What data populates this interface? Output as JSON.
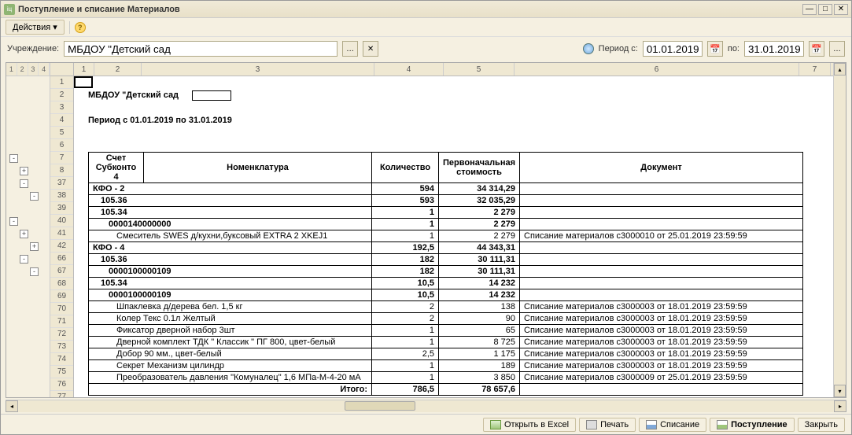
{
  "window_title": "Поступление и списание Материалов",
  "toolbar": {
    "actions_label": "Действия"
  },
  "filter": {
    "org_label": "Учреждение:",
    "org_value": "МБДОУ \"Детский сад",
    "period_label": "Период с:",
    "period_from": "01.01.2019",
    "period_to_label": "по:",
    "period_to": "31.01.2019"
  },
  "outline_levels": [
    "1",
    "2",
    "3",
    "4"
  ],
  "col_headers": [
    "1",
    "2",
    "3",
    "4",
    "5",
    "6",
    "7"
  ],
  "row_numbers": [
    "1",
    "2",
    "3",
    "4",
    "5",
    "6",
    "7",
    "8",
    "37",
    "38",
    "39",
    "40",
    "41",
    "42",
    "66",
    "67",
    "68",
    "69",
    "70",
    "71",
    "72",
    "73",
    "74",
    "75",
    "76",
    "77"
  ],
  "outline_nodes": [
    {
      "row_index": 6,
      "indent": 0,
      "state": "-"
    },
    {
      "row_index": 7,
      "indent": 1,
      "state": "+"
    },
    {
      "row_index": 8,
      "indent": 1,
      "state": "-"
    },
    {
      "row_index": 9,
      "indent": 2,
      "state": "-"
    },
    {
      "row_index": 11,
      "indent": 0,
      "state": "-"
    },
    {
      "row_index": 12,
      "indent": 1,
      "state": "+"
    },
    {
      "row_index": 13,
      "indent": 2,
      "state": "+"
    },
    {
      "row_index": 14,
      "indent": 1,
      "state": "-"
    },
    {
      "row_index": 15,
      "indent": 2,
      "state": "-"
    }
  ],
  "report": {
    "org_title": "МБДОУ \"Детский сад",
    "period_title": "Период с 01.01.2019 по 31.01.2019",
    "headers": {
      "acct": "Счет Субконто 4",
      "nomen": "Номенклатура",
      "qty": "Количество",
      "cost": "Первоначальная стоимость",
      "doc": "Документ"
    },
    "rows": [
      {
        "bold": true,
        "indent": 0,
        "c1": "КФО - 2",
        "c2": "",
        "qty": "594",
        "cost": "34 314,29",
        "doc": ""
      },
      {
        "bold": true,
        "indent": 1,
        "c1": "105.36",
        "c2": "",
        "qty": "593",
        "cost": "32 035,29",
        "doc": ""
      },
      {
        "bold": true,
        "indent": 1,
        "c1": "105.34",
        "c2": "",
        "qty": "1",
        "cost": "2 279",
        "doc": ""
      },
      {
        "bold": true,
        "indent": 2,
        "c1": "0000140000000",
        "c2": "",
        "qty": "1",
        "cost": "2 279",
        "doc": ""
      },
      {
        "bold": false,
        "indent": 3,
        "c1": "",
        "c2": "Смеситель SWES д/кухни,буксовый EXTRA 2 XKEJ1",
        "qty": "1",
        "cost": "2 279",
        "doc": "Списание материалов с3000010 от 25.01.2019 23:59:59"
      },
      {
        "bold": true,
        "indent": 0,
        "c1": "КФО - 4",
        "c2": "",
        "qty": "192,5",
        "cost": "44 343,31",
        "doc": ""
      },
      {
        "bold": true,
        "indent": 1,
        "c1": "105.36",
        "c2": "",
        "qty": "182",
        "cost": "30 111,31",
        "doc": ""
      },
      {
        "bold": true,
        "indent": 2,
        "c1": "0000100000109",
        "c2": "",
        "qty": "182",
        "cost": "30 111,31",
        "doc": ""
      },
      {
        "bold": true,
        "indent": 1,
        "c1": "105.34",
        "c2": "",
        "qty": "10,5",
        "cost": "14 232",
        "doc": ""
      },
      {
        "bold": true,
        "indent": 2,
        "c1": "0000100000109",
        "c2": "",
        "qty": "10,5",
        "cost": "14 232",
        "doc": ""
      },
      {
        "bold": false,
        "indent": 3,
        "c1": "",
        "c2": "Шпаклевка д/дерева бел. 1,5 кг",
        "qty": "2",
        "cost": "138",
        "doc": "Списание материалов с3000003 от 18.01.2019 23:59:59"
      },
      {
        "bold": false,
        "indent": 3,
        "c1": "",
        "c2": "Колер Текс 0.1л Желтый",
        "qty": "2",
        "cost": "90",
        "doc": "Списание материалов с3000003 от 18.01.2019 23:59:59"
      },
      {
        "bold": false,
        "indent": 3,
        "c1": "",
        "c2": "Фиксатор дверной набор 3шт",
        "qty": "1",
        "cost": "65",
        "doc": "Списание материалов с3000003 от 18.01.2019 23:59:59"
      },
      {
        "bold": false,
        "indent": 3,
        "c1": "",
        "c2": "Дверной комплект ТДК \" Классик \" ПГ 800, цвет-белый",
        "qty": "1",
        "cost": "8 725",
        "doc": "Списание материалов с3000003 от 18.01.2019 23:59:59"
      },
      {
        "bold": false,
        "indent": 3,
        "c1": "",
        "c2": "Добор 90 мм., цвет-белый",
        "qty": "2,5",
        "cost": "1 175",
        "doc": "Списание материалов с3000003 от 18.01.2019 23:59:59"
      },
      {
        "bold": false,
        "indent": 3,
        "c1": "",
        "c2": "Секрет Механизм цилиндр",
        "qty": "1",
        "cost": "189",
        "doc": "Списание материалов с3000003 от 18.01.2019 23:59:59"
      },
      {
        "bold": false,
        "indent": 3,
        "c1": "",
        "c2": "Преобразователь давления \"Комуналец\" 1,6 МПа-М-4-20 мА",
        "qty": "1",
        "cost": "3 850",
        "doc": "Списание материалов с3000009 от 25.01.2019 23:59:59"
      }
    ],
    "total": {
      "label": "Итого:",
      "qty": "786,5",
      "cost": "78 657,6"
    }
  },
  "bottom": {
    "excel": "Открыть в Excel",
    "print": "Печать",
    "write_off": "Списание",
    "receipt": "Поступление",
    "close": "Закрыть"
  }
}
